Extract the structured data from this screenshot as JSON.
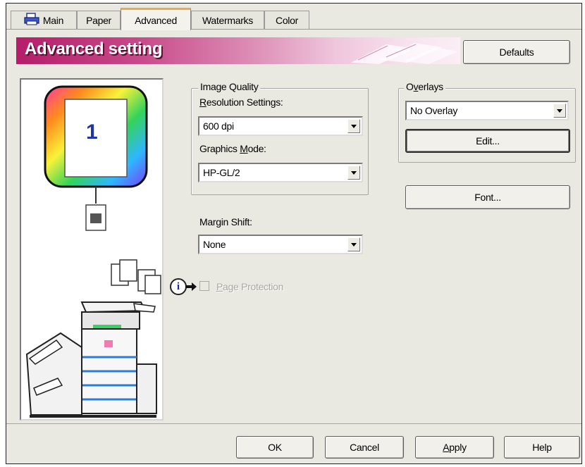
{
  "tabs": [
    {
      "label": "Main",
      "icon": "printer-icon"
    },
    {
      "label": "Paper"
    },
    {
      "label": "Advanced",
      "active": true
    },
    {
      "label": "Watermarks"
    },
    {
      "label": "Color"
    }
  ],
  "header": {
    "title": "Advanced setting",
    "defaults_label": "Defaults"
  },
  "preview": {
    "page_number": "1"
  },
  "image_quality": {
    "legend": "Image Quality",
    "resolution": {
      "label": "Resolution Settings:",
      "value": "600 dpi"
    },
    "graphics_mode": {
      "label": "Graphics Mode:",
      "value": "HP-GL/2"
    }
  },
  "margin_shift": {
    "label": "Margin Shift:",
    "value": "None"
  },
  "page_protection": {
    "label": "Page Protection",
    "checked": false,
    "enabled": false
  },
  "overlays": {
    "legend": "Overlays",
    "value": "No Overlay",
    "edit_label": "Edit..."
  },
  "font_button": "Font...",
  "footer": {
    "ok": "OK",
    "cancel": "Cancel",
    "apply": "Apply",
    "help": "Help"
  },
  "colors": {
    "accent_tab": "#f2a64a",
    "banner_start": "#b51d69",
    "dialog_bg": "#e9e8e1"
  }
}
